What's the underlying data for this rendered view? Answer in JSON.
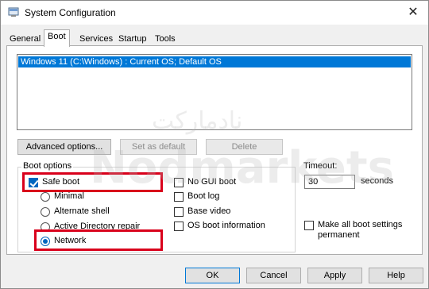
{
  "window": {
    "title": "System Configuration",
    "close_glyph": "✕"
  },
  "tabs": [
    {
      "label": "General"
    },
    {
      "label": "Boot"
    },
    {
      "label": "Services"
    },
    {
      "label": "Startup"
    },
    {
      "label": "Tools"
    }
  ],
  "os_list": {
    "selected_entry": "Windows 11 (C:\\Windows) : Current OS; Default OS"
  },
  "buttons": {
    "advanced": "Advanced options...",
    "set_default": "Set as default",
    "delete": "Delete",
    "ok": "OK",
    "cancel": "Cancel",
    "apply": "Apply",
    "help": "Help"
  },
  "boot_options": {
    "group_label": "Boot options",
    "safe_boot": {
      "label": "Safe boot",
      "checked": true
    },
    "minimal": "Minimal",
    "alternate_shell": "Alternate shell",
    "active_directory_repair": "Active Directory repair",
    "network": {
      "label": "Network",
      "selected": true
    },
    "no_gui_boot": "No GUI boot",
    "boot_log": "Boot log",
    "base_video": "Base video",
    "os_boot_information": "OS boot information"
  },
  "timeout": {
    "label": "Timeout:",
    "value": "30",
    "unit": "seconds"
  },
  "make_permanent": "Make all boot settings permanent",
  "watermark": {
    "arabic": "نادماركت",
    "latin": "Nodmarkets"
  },
  "colors": {
    "selection": "#0078d7",
    "highlight_box": "#d9001b",
    "checkbox_fill": "#0067c0"
  }
}
